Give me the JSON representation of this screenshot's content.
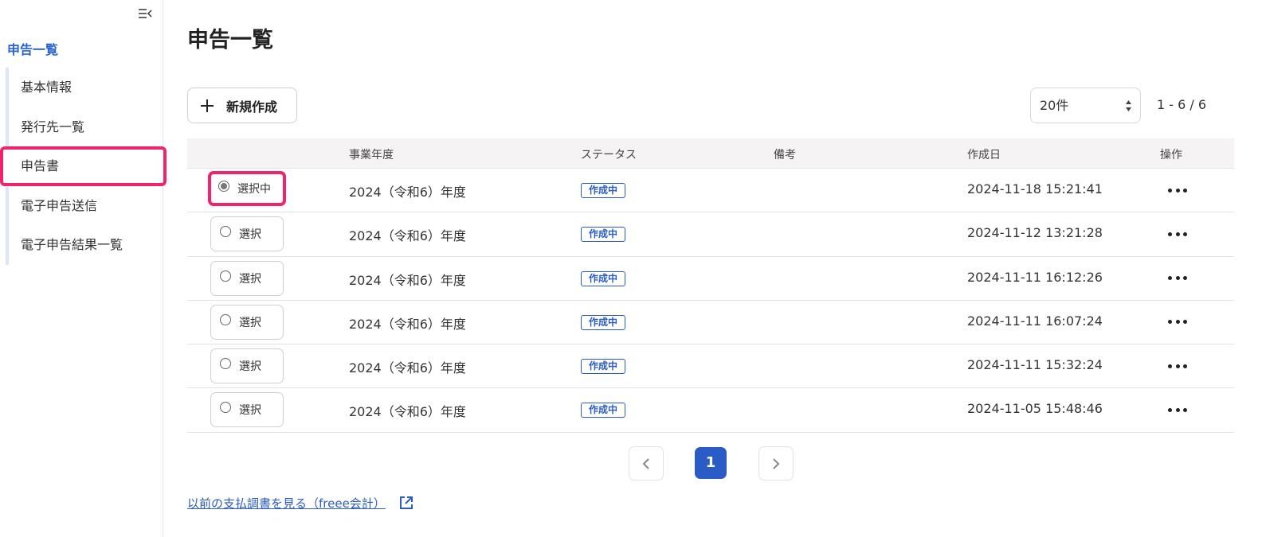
{
  "sidebar": {
    "title": "申告一覧",
    "items": [
      {
        "label": "基本情報"
      },
      {
        "label": "発行先一覧"
      },
      {
        "label": "申告書"
      },
      {
        "label": "電子申告送信"
      },
      {
        "label": "電子申告結果一覧"
      }
    ],
    "active_index": 2
  },
  "page": {
    "title": "申告一覧",
    "new_button_label": "新規作成",
    "per_page_value": "20件",
    "range_text": "1 - 6 / 6"
  },
  "table": {
    "headers": [
      "事業年度",
      "ステータス",
      "備考",
      "作成日",
      "操作"
    ],
    "rows": [
      {
        "select_label": "選択中",
        "selected": true,
        "year": "2024（令和6）年度",
        "status": "作成中",
        "note": "",
        "created": "2024-11-18 15:21:41"
      },
      {
        "select_label": "選択",
        "selected": false,
        "year": "2024（令和6）年度",
        "status": "作成中",
        "note": "",
        "created": "2024-11-12 13:21:28"
      },
      {
        "select_label": "選択",
        "selected": false,
        "year": "2024（令和6）年度",
        "status": "作成中",
        "note": "",
        "created": "2024-11-11 16:12:26"
      },
      {
        "select_label": "選択",
        "selected": false,
        "year": "2024（令和6）年度",
        "status": "作成中",
        "note": "",
        "created": "2024-11-11 16:07:24"
      },
      {
        "select_label": "選択",
        "selected": false,
        "year": "2024（令和6）年度",
        "status": "作成中",
        "note": "",
        "created": "2024-11-11 15:32:24"
      },
      {
        "select_label": "選択",
        "selected": false,
        "year": "2024（令和6）年度",
        "status": "作成中",
        "note": "",
        "created": "2024-11-05 15:48:46"
      }
    ]
  },
  "pagination": {
    "current_page": "1"
  },
  "footer": {
    "link_text": "以前の支払調書を見る（freee会計）"
  },
  "icons": {
    "collapse": "collapse-sidebar-icon",
    "plus": "plus-icon",
    "more": "more-horizontal-icon",
    "prev": "chevron-left-icon",
    "next": "chevron-right-icon",
    "external": "external-link-icon"
  },
  "colors": {
    "accent": "#2b5cc6",
    "highlight": "#f0246c"
  }
}
